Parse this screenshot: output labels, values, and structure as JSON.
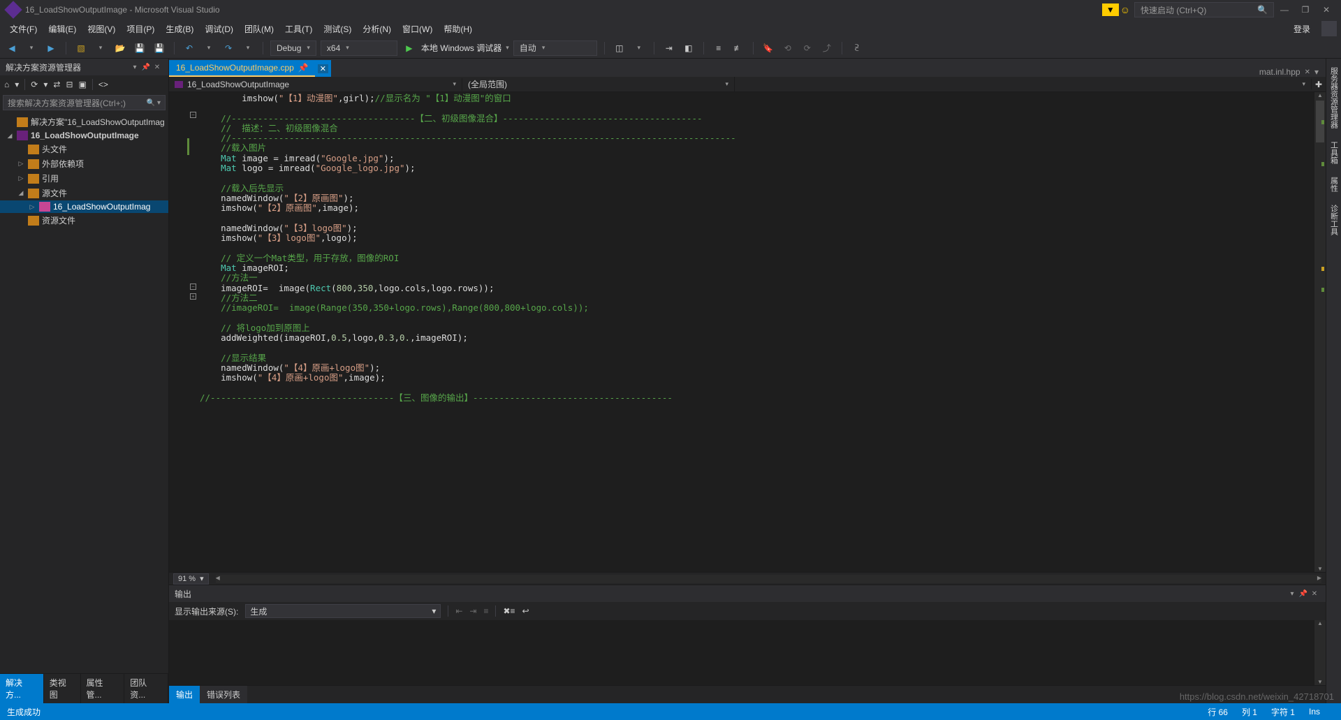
{
  "title": "16_LoadShowOutputImage - Microsoft Visual Studio",
  "quick_launch_placeholder": "快速启动 (Ctrl+Q)",
  "menu": [
    "文件(F)",
    "编辑(E)",
    "视图(V)",
    "项目(P)",
    "生成(B)",
    "调试(D)",
    "团队(M)",
    "工具(T)",
    "测试(S)",
    "分析(N)",
    "窗口(W)",
    "帮助(H)"
  ],
  "login": "登录",
  "toolbar": {
    "config": "Debug",
    "platform": "x64",
    "debugger": "本地 Windows 调试器",
    "run_mode": "自动"
  },
  "solution_explorer": {
    "title": "解决方案资源管理器",
    "search_placeholder": "搜索解决方案资源管理器(Ctrl+;)",
    "items": [
      {
        "level": 0,
        "exp": "",
        "icon": "sln",
        "label": "解决方案\"16_LoadShowOutputImag"
      },
      {
        "level": 0,
        "exp": "◢",
        "icon": "proj",
        "label": "16_LoadShowOutputImage",
        "bold": true
      },
      {
        "level": 1,
        "exp": "",
        "icon": "folder",
        "label": "头文件"
      },
      {
        "level": 1,
        "exp": "▷",
        "icon": "folder",
        "label": "外部依赖项"
      },
      {
        "level": 1,
        "exp": "▷",
        "icon": "folder",
        "label": "引用"
      },
      {
        "level": 1,
        "exp": "◢",
        "icon": "folder",
        "label": "源文件"
      },
      {
        "level": 2,
        "exp": "▷",
        "icon": "cpp",
        "label": "16_LoadShowOutputImag",
        "sel": true
      },
      {
        "level": 1,
        "exp": "",
        "icon": "folder",
        "label": "资源文件"
      }
    ],
    "tabs": [
      "解决方...",
      "类视图",
      "属性管...",
      "团队资..."
    ],
    "active_tab": 0
  },
  "editor": {
    "tabs": [
      {
        "label": "16_LoadShowOutputImage.cpp",
        "active": true,
        "pinned": true,
        "close": true
      }
    ],
    "right_tab": "mat.inl.hpp",
    "breadcrumb": {
      "scope1": "16_LoadShowOutputImage",
      "scope2": "(全局范围)"
    },
    "zoom": "91 %"
  },
  "code_lines": [
    {
      "t": "        imshow(\"【1】动漫图\",girl);//显示名为 \"【1】动漫图\"的窗口",
      "segs": [
        [
          "        imshow(",
          "p"
        ],
        [
          "\"【1】动漫图\"",
          "s"
        ],
        [
          ",girl);",
          "p"
        ],
        [
          "//显示名为 \"【1】动漫图\"的窗口",
          "c"
        ]
      ]
    },
    {
      "t": "",
      "segs": []
    },
    {
      "t": "    //-----------------------------------【二、初级图像混合】--------------------------------------",
      "segs": [
        [
          "    ",
          "p"
        ],
        [
          "//-----------------------------------【二、初级图像混合】--------------------------------------",
          "c"
        ]
      ]
    },
    {
      "t": "    //  描述：二、初级图像混合",
      "segs": [
        [
          "    ",
          "p"
        ],
        [
          "//  描述：二、初级图像混合",
          "c"
        ]
      ]
    },
    {
      "t": "    //------------------------------------------------------------------------------------------------",
      "segs": [
        [
          "    ",
          "p"
        ],
        [
          "//------------------------------------------------------------------------------------------------",
          "c"
        ]
      ]
    },
    {
      "t": "    //载入图片",
      "segs": [
        [
          "    ",
          "p"
        ],
        [
          "//载入图片",
          "c"
        ]
      ]
    },
    {
      "t": "    Mat image = imread(\"Google.jpg\");",
      "segs": [
        [
          "    ",
          "p"
        ],
        [
          "Mat",
          "t"
        ],
        [
          " image = imread(",
          "p"
        ],
        [
          "\"Google.jpg\"",
          "s"
        ],
        [
          ");",
          "p"
        ]
      ]
    },
    {
      "t": "    Mat logo = imread(\"Google_logo.jpg\");",
      "segs": [
        [
          "    ",
          "p"
        ],
        [
          "Mat",
          "t"
        ],
        [
          " logo = imread(",
          "p"
        ],
        [
          "\"Google_logo.jpg\"",
          "s"
        ],
        [
          ");",
          "p"
        ]
      ]
    },
    {
      "t": "",
      "segs": []
    },
    {
      "t": "    //载入后先显示",
      "segs": [
        [
          "    ",
          "p"
        ],
        [
          "//载入后先显示",
          "c"
        ]
      ]
    },
    {
      "t": "    namedWindow(\"【2】原画图\");",
      "segs": [
        [
          "    namedWindow(",
          "p"
        ],
        [
          "\"【2】原画图\"",
          "s"
        ],
        [
          ");",
          "p"
        ]
      ]
    },
    {
      "t": "    imshow(\"【2】原画图\",image);",
      "segs": [
        [
          "    imshow(",
          "p"
        ],
        [
          "\"【2】原画图\"",
          "s"
        ],
        [
          ",image);",
          "p"
        ]
      ]
    },
    {
      "t": "",
      "segs": []
    },
    {
      "t": "    namedWindow(\"【3】logo图\");",
      "segs": [
        [
          "    namedWindow(",
          "p"
        ],
        [
          "\"【3】logo图\"",
          "s"
        ],
        [
          ");",
          "p"
        ]
      ]
    },
    {
      "t": "    imshow(\"【3】logo图\",logo);",
      "segs": [
        [
          "    imshow(",
          "p"
        ],
        [
          "\"【3】logo图\"",
          "s"
        ],
        [
          ",logo);",
          "p"
        ]
      ]
    },
    {
      "t": "",
      "segs": []
    },
    {
      "t": "    // 定义一个Mat类型，用于存放，图像的ROI",
      "segs": [
        [
          "    ",
          "p"
        ],
        [
          "// 定义一个Mat类型，用于存放，图像的ROI",
          "c"
        ]
      ]
    },
    {
      "t": "    Mat imageROI;",
      "segs": [
        [
          "    ",
          "p"
        ],
        [
          "Mat",
          "t"
        ],
        [
          " imageROI;",
          "p"
        ]
      ]
    },
    {
      "t": "    //方法一",
      "segs": [
        [
          "    ",
          "p"
        ],
        [
          "//方法一",
          "c"
        ]
      ]
    },
    {
      "t": "    imageROI=  image(Rect(800,350,logo.cols,logo.rows));",
      "segs": [
        [
          "    imageROI=  image(",
          "p"
        ],
        [
          "Rect",
          "t"
        ],
        [
          "(",
          "p"
        ],
        [
          "800",
          "n"
        ],
        [
          ",",
          "p"
        ],
        [
          "350",
          "n"
        ],
        [
          ",logo.cols,logo.rows));",
          "p"
        ]
      ]
    },
    {
      "t": "    //方法二",
      "segs": [
        [
          "    ",
          "p"
        ],
        [
          "//方法二",
          "c"
        ]
      ]
    },
    {
      "t": "    //imageROI=  image(Range(350,350+logo.rows),Range(800,800+logo.cols));",
      "segs": [
        [
          "    ",
          "p"
        ],
        [
          "//imageROI=  image(Range(350,350+logo.rows),Range(800,800+logo.cols));",
          "c"
        ]
      ]
    },
    {
      "t": "",
      "segs": []
    },
    {
      "t": "    // 将logo加到原图上",
      "segs": [
        [
          "    ",
          "p"
        ],
        [
          "// 将logo加到原图上",
          "c"
        ]
      ]
    },
    {
      "t": "    addWeighted(imageROI,0.5,logo,0.3,0.,imageROI);",
      "segs": [
        [
          "    addWeighted(imageROI,",
          "p"
        ],
        [
          "0.5",
          "n"
        ],
        [
          ",logo,",
          "p"
        ],
        [
          "0.3",
          "n"
        ],
        [
          ",",
          "p"
        ],
        [
          "0.",
          "n"
        ],
        [
          ",imageROI);",
          "p"
        ]
      ]
    },
    {
      "t": "",
      "segs": []
    },
    {
      "t": "    //显示结果",
      "segs": [
        [
          "    ",
          "p"
        ],
        [
          "//显示结果",
          "c"
        ]
      ]
    },
    {
      "t": "    namedWindow(\"【4】原画+logo图\");",
      "segs": [
        [
          "    namedWindow(",
          "p"
        ],
        [
          "\"【4】原画+logo图\"",
          "s"
        ],
        [
          ");",
          "p"
        ]
      ]
    },
    {
      "t": "    imshow(\"【4】原画+logo图\",image);",
      "segs": [
        [
          "    imshow(",
          "p"
        ],
        [
          "\"【4】原画+logo图\"",
          "s"
        ],
        [
          ",image);",
          "p"
        ]
      ]
    },
    {
      "t": "",
      "segs": []
    },
    {
      "t": "//-----------------------------------【三、图像的输出】--------------------------------------",
      "segs": [
        [
          "//-----------------------------------【三、图像的输出】--------------------------------------",
          "c"
        ]
      ]
    }
  ],
  "output": {
    "title": "输出",
    "source_label": "显示输出来源(S):",
    "source_value": "生成",
    "tabs": [
      "输出",
      "错误列表"
    ],
    "active_tab": 0
  },
  "right_tabs": [
    "服务器资源管理器",
    "工具箱",
    "属性",
    "诊断工具"
  ],
  "status": {
    "build": "生成成功",
    "line": "行 66",
    "col": "列 1",
    "char": "字符 1",
    "ins": "Ins",
    "url": "https://blog.csdn.net/weixin_42718701"
  }
}
